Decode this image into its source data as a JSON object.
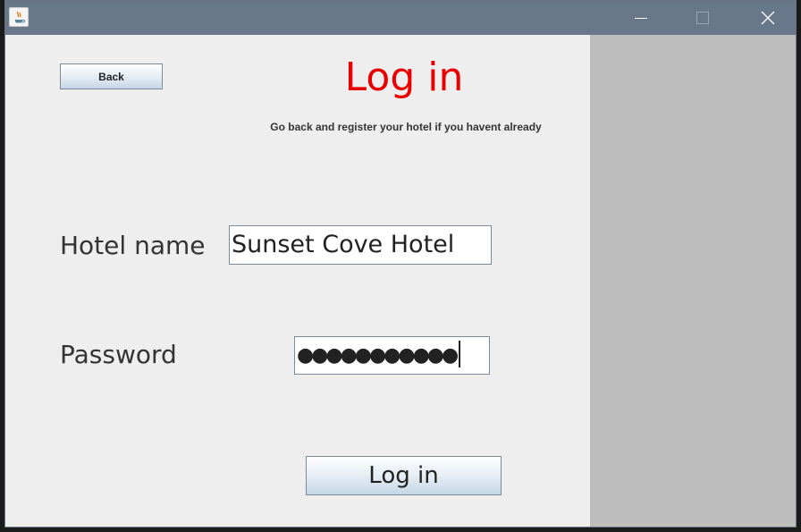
{
  "window": {
    "controls": {
      "minimize_icon": "minimize-icon",
      "maximize_icon": "maximize-icon",
      "close_icon": "close-icon"
    },
    "app_icon": "java-icon"
  },
  "form": {
    "back_label": "Back",
    "title": "Log in",
    "subtitle": "Go back and register your hotel if you havent already",
    "hotel_name_label": "Hotel name",
    "hotel_name_value": "Sunset Cove Hotel",
    "password_label": "Password",
    "password_masked": "●●●●●●●●●●●",
    "login_label": "Log in"
  },
  "colors": {
    "title": "#e80000",
    "titlebar": "#687789",
    "panel": "#eeeeee",
    "side_area": "#bdbdbd"
  }
}
